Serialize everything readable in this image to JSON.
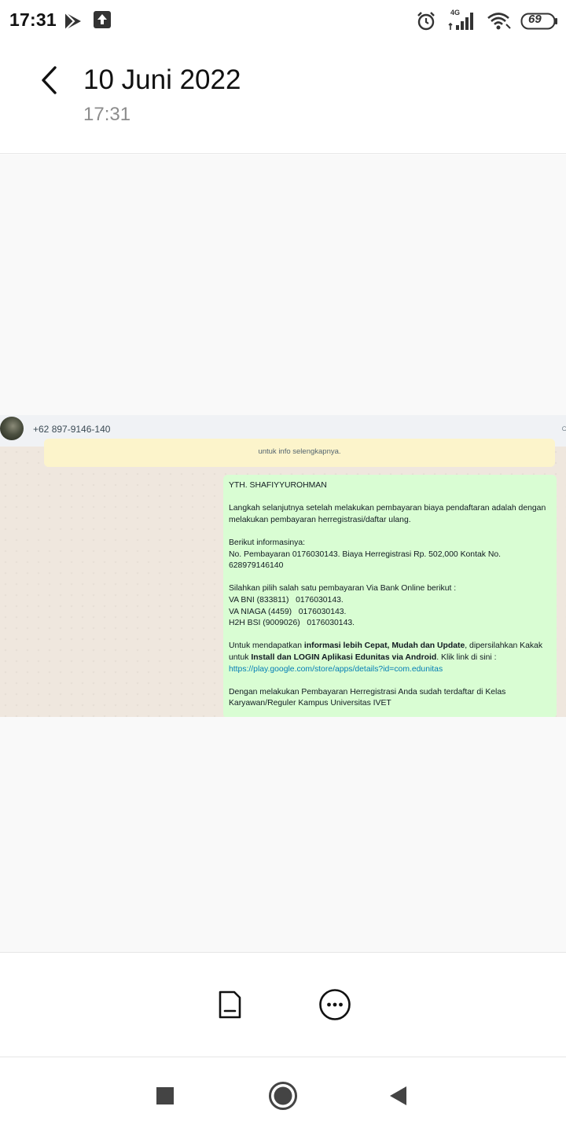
{
  "status_bar": {
    "time": "17:31",
    "battery": "69",
    "network": "4G",
    "icons": [
      "play-store-icon",
      "upload-icon",
      "alarm-icon",
      "signal-icon",
      "wifi-icon",
      "battery-icon"
    ]
  },
  "header": {
    "title": "10 Juni 2022",
    "subtitle": "17:31",
    "back_icon": "chevron-left-icon"
  },
  "screenshot": {
    "contact": "+62 897-9146-140",
    "notice_line2": "untuk info selengkapnya.",
    "message": {
      "greeting": "YTH. SHAFIYYUROHMAN",
      "para1": "Langkah selanjutnya setelah melakukan pembayaran biaya pendaftaran adalah dengan melakukan pembayaran herregistrasi/daftar ulang.",
      "info_title": "Berikut informasinya:",
      "info_body": "No. Pembayaran 0176030143. Biaya Herregistrasi Rp. 502,000 Kontak No. 628979146140",
      "bank_intro": "Silahkan pilih salah satu pembayaran Via Bank Online berikut :",
      "bank1": "VA BNI (833811)   0176030143.",
      "bank2": "VA NIAGA (4459)   0176030143.",
      "bank3": "H2H BSI (9009026)   0176030143.",
      "app_pre": "Untuk mendapatkan ",
      "app_bold1": "informasi lebih Cepat, Mudah dan Update",
      "app_mid": ", dipersilahkan Kakak untuk ",
      "app_bold2": "Install dan LOGIN Aplikasi Edunitas via Android",
      "app_post": ". Klik link di sini :",
      "link": "https://play.google.com/store/apps/details?id=com.edunitas",
      "closing": "Dengan melakukan Pembayaran Herregistrasi  Anda sudah terdaftar di Kelas Karyawan/Reguler Kampus Universitas IVET"
    }
  },
  "actions": {
    "icons": [
      "save-sim-icon",
      "more-options-icon"
    ]
  },
  "nav": {
    "icons": [
      "recents-square-icon",
      "home-circle-icon",
      "back-triangle-icon"
    ]
  },
  "colors": {
    "bubble": "#d9fdd3",
    "notice": "#fcf4cb",
    "link": "#027eb5",
    "viewer_bg": "#f9f9f9"
  }
}
